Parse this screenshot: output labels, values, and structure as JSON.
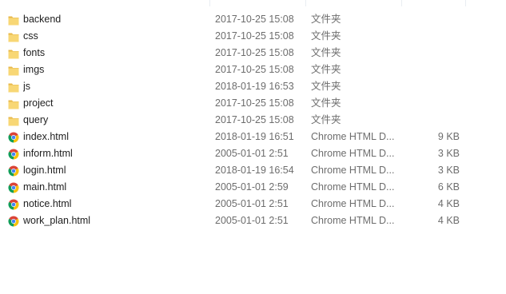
{
  "files": [
    {
      "name": "backend",
      "modified": "2017-10-25 15:08",
      "type": "文件夹",
      "size": "",
      "icon": "folder-icon"
    },
    {
      "name": "css",
      "modified": "2017-10-25 15:08",
      "type": "文件夹",
      "size": "",
      "icon": "folder-icon"
    },
    {
      "name": "fonts",
      "modified": "2017-10-25 15:08",
      "type": "文件夹",
      "size": "",
      "icon": "folder-icon"
    },
    {
      "name": "imgs",
      "modified": "2017-10-25 15:08",
      "type": "文件夹",
      "size": "",
      "icon": "folder-icon"
    },
    {
      "name": "js",
      "modified": "2018-01-19 16:53",
      "type": "文件夹",
      "size": "",
      "icon": "folder-icon"
    },
    {
      "name": "project",
      "modified": "2017-10-25 15:08",
      "type": "文件夹",
      "size": "",
      "icon": "folder-icon"
    },
    {
      "name": "query",
      "modified": "2017-10-25 15:08",
      "type": "文件夹",
      "size": "",
      "icon": "folder-icon"
    },
    {
      "name": "index.html",
      "modified": "2018-01-19 16:51",
      "type": "Chrome HTML D...",
      "size": "9 KB",
      "icon": "chrome-icon"
    },
    {
      "name": "inform.html",
      "modified": "2005-01-01 2:51",
      "type": "Chrome HTML D...",
      "size": "3 KB",
      "icon": "chrome-icon"
    },
    {
      "name": "login.html",
      "modified": "2018-01-19 16:54",
      "type": "Chrome HTML D...",
      "size": "3 KB",
      "icon": "chrome-icon"
    },
    {
      "name": "main.html",
      "modified": "2005-01-01 2:59",
      "type": "Chrome HTML D...",
      "size": "6 KB",
      "icon": "chrome-icon"
    },
    {
      "name": "notice.html",
      "modified": "2005-01-01 2:51",
      "type": "Chrome HTML D...",
      "size": "4 KB",
      "icon": "chrome-icon"
    },
    {
      "name": "work_plan.html",
      "modified": "2005-01-01 2:51",
      "type": "Chrome HTML D...",
      "size": "4 KB",
      "icon": "chrome-icon"
    }
  ],
  "colors": {
    "folder_body": "#f8d775",
    "folder_tab": "#e8b84a",
    "chrome_red": "#db4437",
    "chrome_yellow": "#f4c20d",
    "chrome_green": "#0f9d58",
    "chrome_blue": "#4285f4",
    "text": "#1e1e1e",
    "secondary_text": "#6d6d6d"
  }
}
